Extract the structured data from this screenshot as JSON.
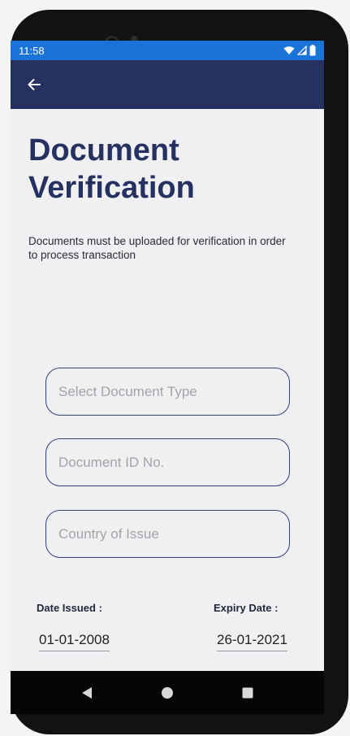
{
  "status_bar": {
    "time": "11:58",
    "icons": [
      "wifi-icon",
      "signal-icon",
      "battery-icon"
    ]
  },
  "app_bar": {
    "back_icon": "arrow-left-icon"
  },
  "page": {
    "title_line1": "Document",
    "title_line2": "Verification",
    "description": "Documents must be uploaded for verification in order to process transaction"
  },
  "form": {
    "document_type_placeholder": "Select Document Type",
    "document_id_placeholder": "Document ID No.",
    "country_placeholder": "Country of Issue",
    "date_issued_label": "Date Issued :",
    "date_issued_value": "01-01-2008",
    "expiry_date_label": "Expiry Date :",
    "expiry_date_value": "26-01-2021"
  },
  "navigation": {
    "buttons": [
      "back-triangle-icon",
      "home-circle-icon",
      "recents-square-icon"
    ]
  },
  "colors": {
    "status_bar": "#1a73d9",
    "app_bar": "#253261",
    "title": "#253261",
    "field_border": "#33407a",
    "submit_button": "#f25a4e"
  }
}
